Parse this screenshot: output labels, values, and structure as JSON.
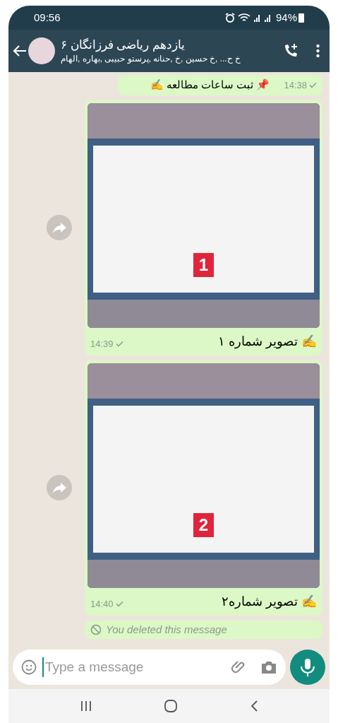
{
  "status_bar": {
    "time": "09:56",
    "battery": "94%"
  },
  "header": {
    "title": "یازدهم ریاضی فرزانگان ۶",
    "members": "خ ح... ,خ حسین ,خ ,حنانه ,پرستو حبیبی ,بهاره ,الهام"
  },
  "messages": [
    {
      "kind": "text",
      "text": "📌 ثبت ساعات مطالعه ✍️",
      "time": "14:38",
      "read": false
    },
    {
      "kind": "image",
      "image_label": "1",
      "caption": "✍️ تصویر شماره ۱",
      "time": "14:39",
      "read": false
    },
    {
      "kind": "image",
      "image_label": "2",
      "caption": "✍️ تصویر شماره۲",
      "time": "14:40",
      "read": false
    },
    {
      "kind": "deleted",
      "text": "You deleted this message"
    }
  ],
  "composer": {
    "placeholder": "Type a message"
  }
}
